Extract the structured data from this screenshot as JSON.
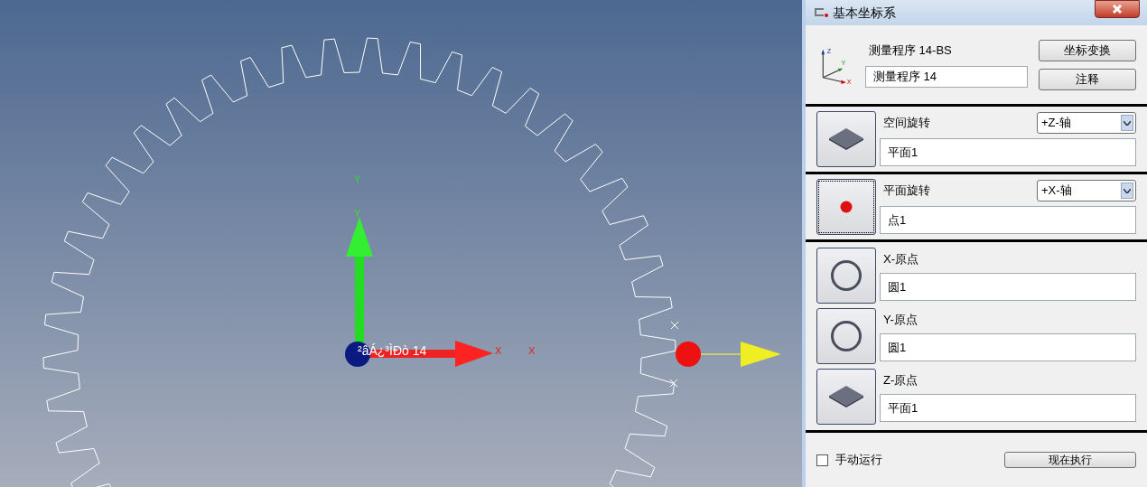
{
  "viewport": {
    "origin_label": "²âÁ¿³ÌÐò 14",
    "y_labels": [
      "Y",
      "Y"
    ],
    "x_labels": [
      "X",
      "X"
    ]
  },
  "window": {
    "title": "基本坐标系"
  },
  "header": {
    "program_name": "测量程序 14-BS",
    "program_field": "测量程序 14",
    "buttons": [
      "坐标变换",
      "注释"
    ],
    "axis_icon_labels": [
      "Z",
      "Y",
      "X"
    ]
  },
  "rotations": [
    {
      "label": "空间旋转",
      "axis": "+Z-轴",
      "value": "平面1",
      "kind": "plane",
      "focused": false
    },
    {
      "label": "平面旋转",
      "axis": "+X-轴",
      "value": "点1",
      "kind": "point",
      "focused": true
    }
  ],
  "origins": [
    {
      "label": "X-原点",
      "value": "圆1",
      "kind": "circle"
    },
    {
      "label": "Y-原点",
      "value": "圆1",
      "kind": "circle"
    },
    {
      "label": "Z-原点",
      "value": "平面1",
      "kind": "plane"
    }
  ],
  "footer": {
    "manual_run": {
      "label": "手动运行",
      "checked": false
    },
    "button": "现在执行"
  }
}
